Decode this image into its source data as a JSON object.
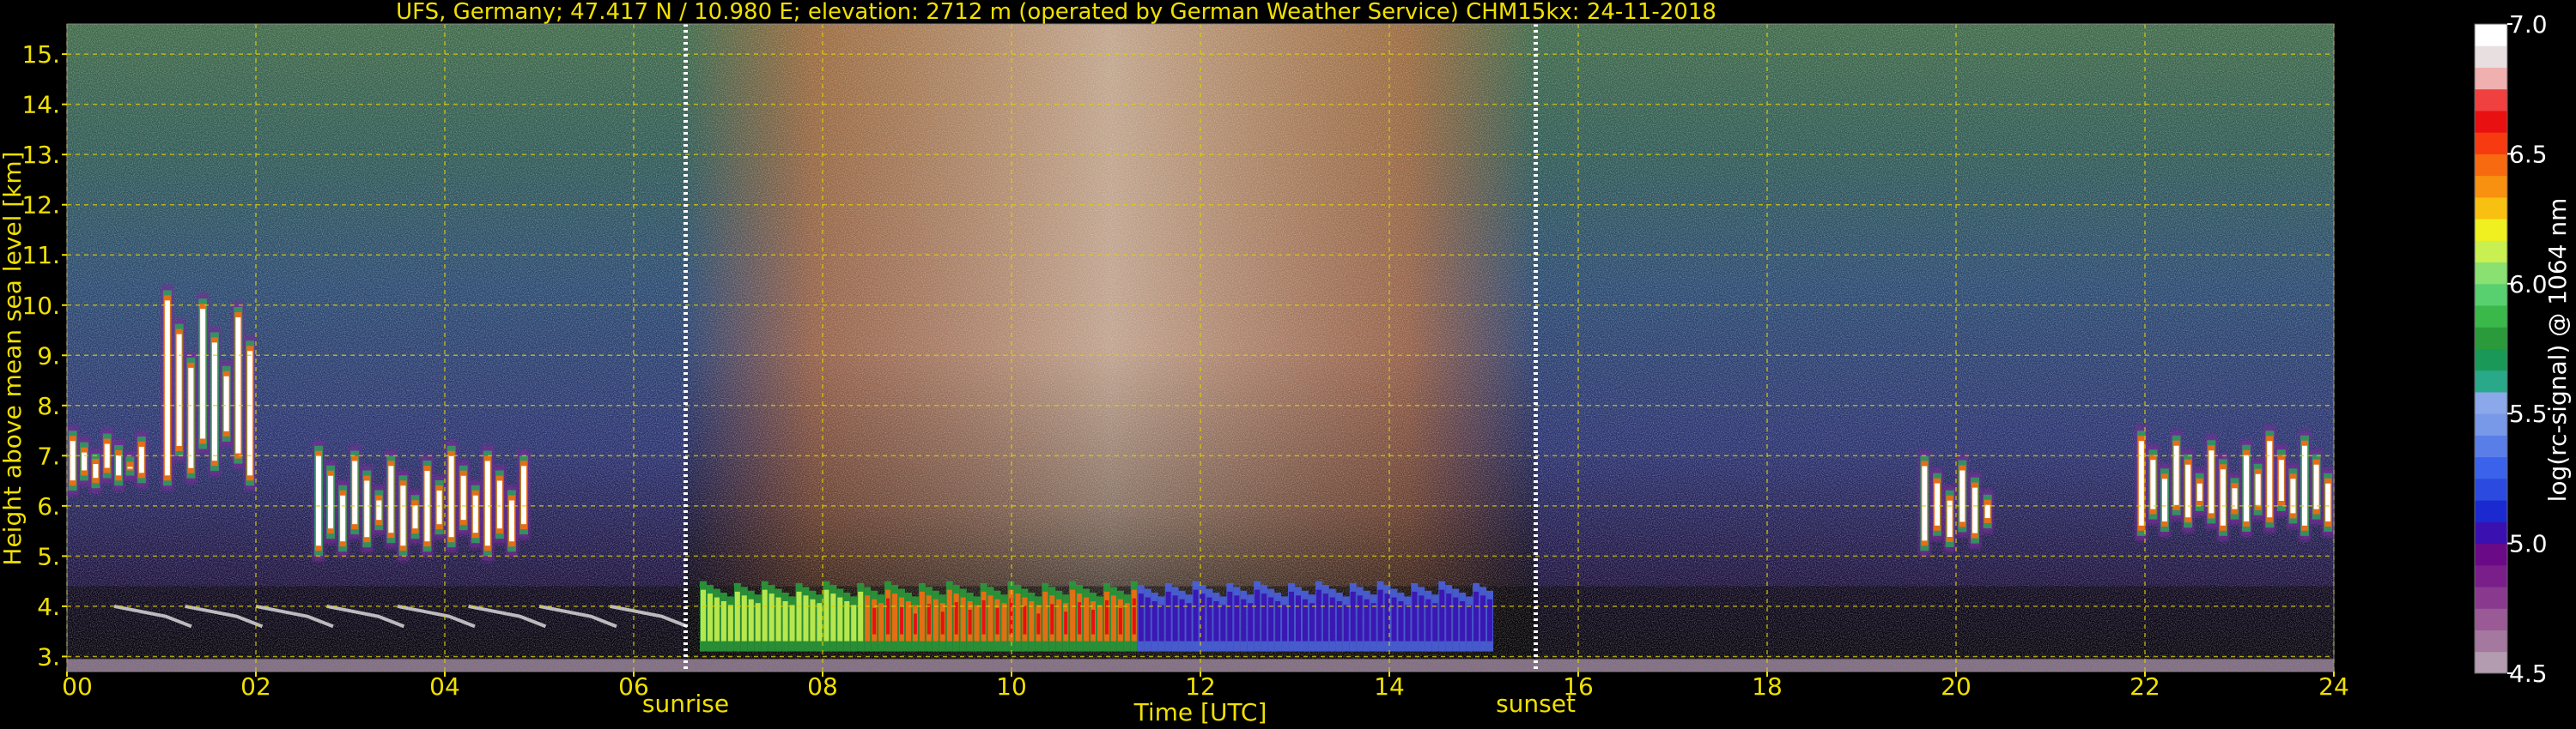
{
  "chart_data": {
    "type": "heatmap",
    "title": "UFS, Germany; 47.417 N / 10.980 E; elevation: 2712 m  (operated by German Weather Service)    CHM15kx: 24-11-2018",
    "xlabel": "Time [UTC]",
    "ylabel": "Height above mean sea level [km]",
    "xlim": [
      0,
      24
    ],
    "ylim": [
      2.7,
      15.6
    ],
    "x_ticks": [
      "00",
      "02",
      "04",
      "06",
      "08",
      "10",
      "12",
      "14",
      "16",
      "18",
      "20",
      "22",
      "24"
    ],
    "y_ticks": [
      "3.",
      "4.",
      "5.",
      "6.",
      "7.",
      "8.",
      "9.",
      "10.",
      "11.",
      "12.",
      "13.",
      "14.",
      "15."
    ],
    "grid": true,
    "events": [
      {
        "label": "sunrise",
        "time": 6.55
      },
      {
        "label": "sunset",
        "time": 15.55
      }
    ],
    "colorbar": {
      "label": "log(rc-signal) @ 1064 nm",
      "range": [
        4.5,
        7.0
      ],
      "tick_labels": [
        "4.5",
        "5.0",
        "5.5",
        "6.0",
        "6.5",
        "7.0"
      ],
      "colors": [
        "#b49cb0",
        "#a5789f",
        "#9a5a95",
        "#8a3a8e",
        "#7a1e8a",
        "#6a0a86",
        "#3a10b0",
        "#1a2ad0",
        "#2a4ae0",
        "#3a62ea",
        "#5a7ee8",
        "#7898e8",
        "#8aa8ea",
        "#2aa88a",
        "#1a9858",
        "#2a9a3a",
        "#3ab84a",
        "#58d070",
        "#8ae070",
        "#c8f050",
        "#f0f020",
        "#f8c010",
        "#f89010",
        "#f86a10",
        "#f83a10",
        "#e81010",
        "#f04040",
        "#f0b0b0",
        "#e8e0e0",
        "#ffffff"
      ]
    },
    "features": [
      {
        "kind": "cloud",
        "t0": 0.0,
        "t1": 0.85,
        "h0": 6.2,
        "h1": 7.6
      },
      {
        "kind": "cloud",
        "t0": 1.0,
        "t1": 2.0,
        "h0": 6.3,
        "h1": 10.4
      },
      {
        "kind": "cloud",
        "t0": 2.6,
        "t1": 4.9,
        "h0": 4.9,
        "h1": 7.3
      },
      {
        "kind": "cloud",
        "t0": 19.6,
        "t1": 20.4,
        "h0": 5.0,
        "h1": 7.1
      },
      {
        "kind": "cloud",
        "t0": 21.9,
        "t1": 24.0,
        "h0": 5.3,
        "h1": 7.6
      },
      {
        "kind": "aerosol_layer",
        "t0": 6.7,
        "t1": 15.1,
        "h0": 3.1,
        "h1": 4.5
      },
      {
        "kind": "low_layer",
        "t0": 0.5,
        "t1": 6.5,
        "h0": 3.0,
        "h1": 4.1
      }
    ]
  }
}
